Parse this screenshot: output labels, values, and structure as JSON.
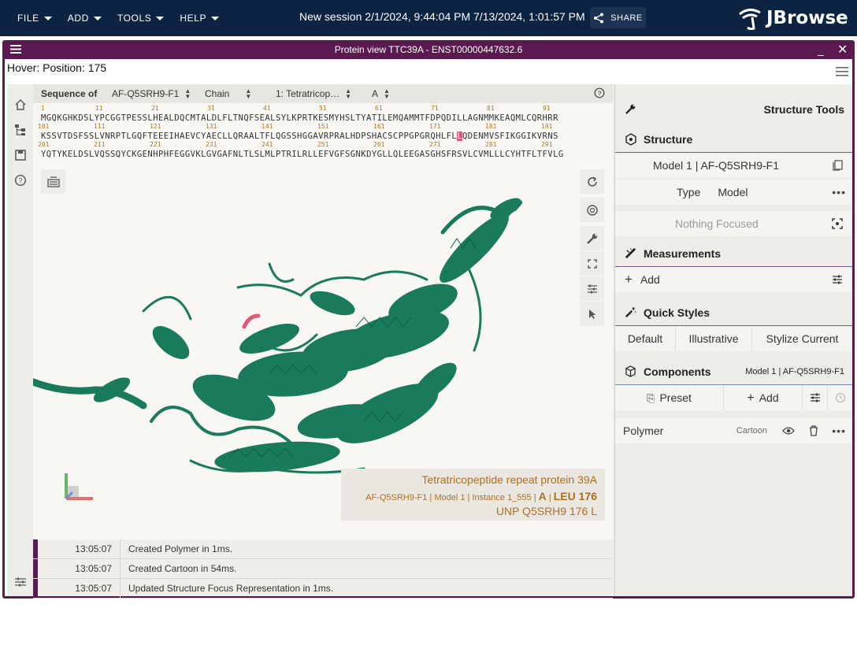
{
  "appbar": {
    "menus": [
      "FILE",
      "ADD",
      "TOOLS",
      "HELP"
    ],
    "session_title": "New session 2/1/2024, 9:44:04 PM 7/13/2024, 1:01:57 PM",
    "share_label": "SHARE",
    "logo_text": "JBrowse"
  },
  "view": {
    "title": "Protein view TTC39A - ENST00000447632.6",
    "hover_text": "Hover: Position: 175"
  },
  "sequence": {
    "label": "Sequence of",
    "selects": [
      "AF-Q5SRH9-F1",
      "Chain",
      "1: Tetratricop…",
      "A"
    ],
    "line1": "MGQKGHKDSLYPCGGTPESSLHEALDQCMTALDLFLTNQFSEALSYLKPRTKESMYHSLTYATILEMQAMMTFDPQDILLAGNMMKEAQMLCQRHRR",
    "line2_a": "KSSVTDSFSSLVNRPTLGQFTEEEIHAEVCYAECLLQRAALTFLQGSSHGGAVRPRALHDPSHACSCPPGPGRQHLFL",
    "line2_hl": "L",
    "line2_b": "QDENMVSFIKGGIKVRNS",
    "line3": "YQTYKELDSLVQSSQYCKGENHPHFEGGVKLGVGAFNLTLSLMLPTRILRLLEFVGFSGNKDYGLLQLEEGASGHSFRSVLCVMLLLCYHTFLTFVLG",
    "nums_row1": [
      "1",
      "11",
      "21",
      "31",
      "41",
      "51",
      "61",
      "71",
      "81",
      "91"
    ],
    "nums_row2": [
      "101",
      "111",
      "121",
      "131",
      "141",
      "151",
      "161",
      "171",
      "181",
      "191"
    ],
    "nums_row3": [
      "201",
      "211",
      "221",
      "231",
      "241",
      "251",
      "261",
      "271",
      "281",
      "291"
    ]
  },
  "structure_label": {
    "name": "Tetratricopeptide repeat protein 39A",
    "path_prefix": "AF-Q5SRH9-F1 | Model 1 | Instance 1_555 |",
    "chain": "A",
    "residue": "LEU 176",
    "unp": "UNP Q5SRH9 176 L"
  },
  "log": [
    {
      "time": "13:05:07",
      "msg": "Created Polymer in 1ms."
    },
    {
      "time": "13:05:07",
      "msg": "Created Cartoon in 54ms."
    },
    {
      "time": "13:05:07",
      "msg": "Updated Structure Focus Representation in 1ms."
    }
  ],
  "right_panel": {
    "tools_title": "Structure Tools",
    "structure_title": "Structure",
    "model_select": "Model 1 | AF-Q5SRH9-F1",
    "type_label": "Type",
    "type_value": "Model",
    "focus_text": "Nothing Focused",
    "measurements_title": "Measurements",
    "add_label": "Add",
    "quick_styles_title": "Quick Styles",
    "quick_styles": [
      "Default",
      "Illustrative",
      "Stylize Current"
    ],
    "components_title": "Components",
    "components_model": "Model 1 | AF-Q5SRH9-F1",
    "preset_label": "Preset",
    "comp_add_label": "Add",
    "polymer_label": "Polymer",
    "polymer_repr": "Cartoon"
  },
  "colors": {
    "appbar": "#0c2341",
    "view_frame": "#5a1a4f",
    "protein": "#1a7a5c",
    "highlight": "#e05a7a",
    "label_text": "#b06e20"
  },
  "icons": [
    "home-icon",
    "tree-icon",
    "save-icon",
    "help-icon",
    "reset-icon",
    "camera-icon",
    "wrench-icon",
    "expand-icon",
    "sliders-icon",
    "pointer-icon",
    "eye-icon",
    "delete-icon",
    "share-icon"
  ]
}
